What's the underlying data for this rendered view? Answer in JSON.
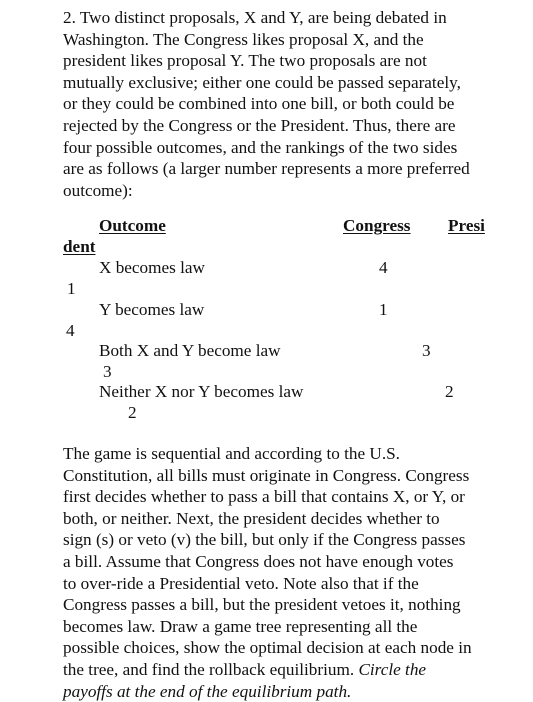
{
  "intro": {
    "lines": [
      "2. Two distinct proposals, X and Y, are being debated in",
      "Washington.  The Congress likes proposal X, and the",
      "president likes proposal Y.  The two proposals are not",
      "mutually exclusive; either one could be passed separately,",
      "or they could be combined into one bill, or both could be",
      "rejected by the Congress or the President.  Thus, there are",
      "four possible outcomes, and the rankings of the two sides",
      "are as follows (a larger number represents a more preferred",
      "outcome):"
    ]
  },
  "table": {
    "headers": {
      "outcome": "Outcome",
      "congress": "Congress",
      "president_part1": "Presi",
      "president_part2": "dent"
    },
    "rows": [
      {
        "outcome": "X becomes law",
        "congress": "4",
        "president": "1"
      },
      {
        "outcome": "Y becomes law",
        "congress": "1",
        "president": "4"
      },
      {
        "outcome": "Both X and Y become law",
        "congress": "3",
        "president": "3"
      },
      {
        "outcome": "Neither X nor Y becomes law",
        "congress": "2",
        "president": "2"
      }
    ]
  },
  "body": {
    "lines": [
      "The game is sequential and according to the U.S.",
      "Constitution, all bills must originate in Congress.  Congress",
      "first decides whether to pass a bill that contains X, or Y, or",
      "both, or neither.  Next, the president decides whether to",
      "sign (s) or veto (v) the bill, but only if the Congress passes",
      "a bill.  Assume that Congress does not have enough votes",
      "to over-ride a Presidential veto.  Note also that if the",
      "Congress passes a bill, but the president vetoes it, nothing",
      "becomes law.  Draw a game tree representing all the",
      "possible choices, show the optimal decision at each node in"
    ],
    "last_line_plain": "the tree, and find the rollback equilibrium. ",
    "last_line_italic": "Circle the",
    "final_italic_line": "payoffs at the end of the equilibrium path."
  }
}
